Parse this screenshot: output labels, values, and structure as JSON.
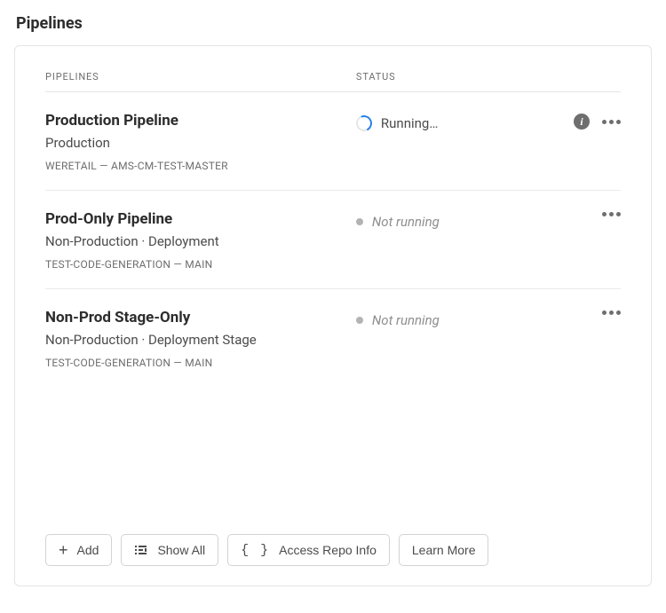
{
  "page_title": "Pipelines",
  "columns": {
    "name": "PIPELINES",
    "status": "STATUS"
  },
  "pipelines": [
    {
      "name": "Production Pipeline",
      "subtitle": "Production",
      "meta": "WERETAIL — AMS-CM-TEST-MASTER",
      "status_text": "Running…",
      "status_kind": "running",
      "show_info": true
    },
    {
      "name": "Prod-Only Pipeline",
      "subtitle": "Non-Production  ·  Deployment",
      "meta": "TEST-CODE-GENERATION — MAIN",
      "status_text": "Not running",
      "status_kind": "idle",
      "show_info": false
    },
    {
      "name": "Non-Prod Stage-Only",
      "subtitle": "Non-Production  ·  Deployment Stage",
      "meta": "TEST-CODE-GENERATION — MAIN",
      "status_text": "Not running",
      "status_kind": "idle",
      "show_info": false
    }
  ],
  "footer": {
    "add": "Add",
    "show_all": "Show All",
    "access_repo": "Access Repo Info",
    "learn_more": "Learn More"
  }
}
